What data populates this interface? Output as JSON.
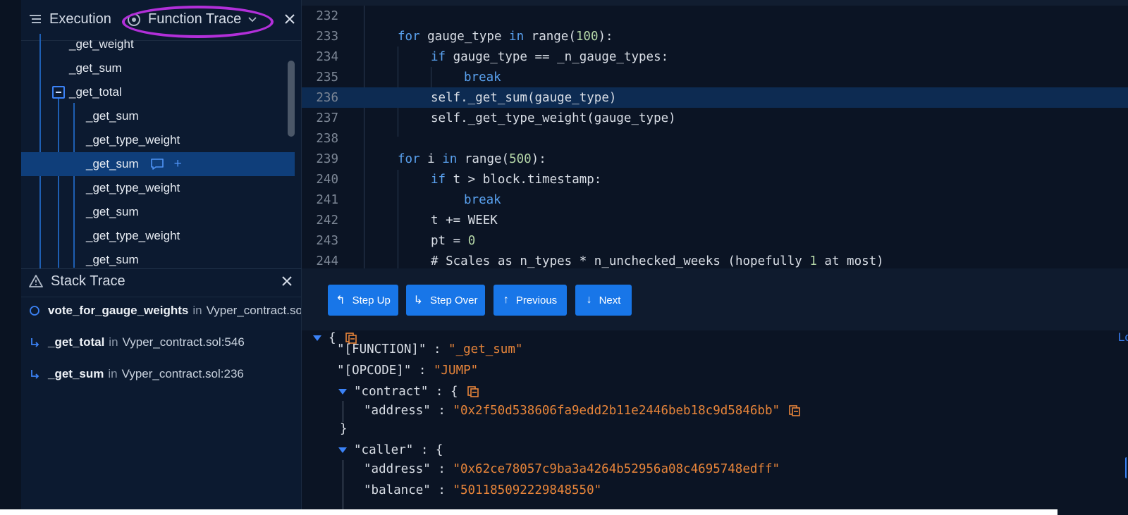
{
  "function_trace_panel": {
    "tab_execution": "Execution",
    "tab_function_trace": "Function Trace",
    "tree_items": [
      {
        "label": "_get_weight",
        "level": 1
      },
      {
        "label": "_get_sum",
        "level": 1
      },
      {
        "label": "_get_total",
        "level": 1,
        "collapsible": true
      },
      {
        "label": "_get_sum",
        "level": 2
      },
      {
        "label": "_get_type_weight",
        "level": 2
      },
      {
        "label": "_get_sum",
        "level": 2,
        "selected": true
      },
      {
        "label": "_get_type_weight",
        "level": 2
      },
      {
        "label": "_get_sum",
        "level": 2
      },
      {
        "label": "_get_type_weight",
        "level": 2
      },
      {
        "label": "_get_sum",
        "level": 2
      }
    ],
    "selected_row_plus": "+"
  },
  "stack_trace_panel": {
    "title": "Stack Trace",
    "frames": [
      {
        "fn": "vote_for_gauge_weights",
        "in": "in",
        "loc": "Vyper_contract.sol"
      },
      {
        "fn": "_get_total",
        "in": "in",
        "loc": "Vyper_contract.sol:546"
      },
      {
        "fn": "_get_sum",
        "in": "in",
        "loc": "Vyper_contract.sol:236"
      }
    ]
  },
  "editor": {
    "active_line": "236",
    "lines": [
      {
        "n": "232"
      },
      {
        "n": "233",
        "parts": [
          [
            "kw",
            "for"
          ],
          [
            "t",
            " gauge_type "
          ],
          [
            "kw",
            "in"
          ],
          [
            "t",
            " range("
          ],
          [
            "num",
            "100"
          ],
          [
            "t",
            "):"
          ]
        ]
      },
      {
        "n": "234",
        "parts": [
          [
            "kw",
            "if"
          ],
          [
            "t",
            " gauge_type == _n_gauge_types:"
          ]
        ]
      },
      {
        "n": "235",
        "parts": [
          [
            "kw",
            "break"
          ]
        ]
      },
      {
        "n": "236",
        "parts": [
          [
            "t",
            "self._get_sum(gauge_type)"
          ]
        ]
      },
      {
        "n": "237",
        "parts": [
          [
            "t",
            "self._get_type_weight(gauge_type)"
          ]
        ]
      },
      {
        "n": "238"
      },
      {
        "n": "239",
        "parts": [
          [
            "kw",
            "for"
          ],
          [
            "t",
            " i "
          ],
          [
            "kw",
            "in"
          ],
          [
            "t",
            " range("
          ],
          [
            "num",
            "500"
          ],
          [
            "t",
            "):"
          ]
        ]
      },
      {
        "n": "240",
        "parts": [
          [
            "kw",
            "if"
          ],
          [
            "t",
            " t > block.timestamp:"
          ]
        ]
      },
      {
        "n": "241",
        "parts": [
          [
            "kw",
            "break"
          ]
        ]
      },
      {
        "n": "242",
        "parts": [
          [
            "t",
            "t += WEEK"
          ]
        ]
      },
      {
        "n": "243",
        "parts": [
          [
            "t",
            "pt = "
          ],
          [
            "num",
            "0"
          ]
        ]
      },
      {
        "n": "244",
        "parts": [
          [
            "t",
            "# Scales as n_types * n_unchecked_weeks (hopefully "
          ],
          [
            "num",
            "1"
          ],
          [
            "t",
            " at most)"
          ]
        ]
      }
    ]
  },
  "toolbar": {
    "step_up": "Step Up",
    "step_over": "Step Over",
    "previous": "Previous",
    "next": "Next"
  },
  "json_viewer": {
    "open_brace": "{",
    "function_key": "\"[FUNCTION]\"",
    "function_value": "\"_get_sum\"",
    "opcode_key": "\"[OPCODE]\"",
    "opcode_value": "\"JUMP\"",
    "contract_key": "\"contract\"",
    "contract_address_key": "\"address\"",
    "contract_address_value": "\"0x2f50d538606fa9edd2b11e2446beb18c9d5846bb\"",
    "close_brace": "}",
    "caller_key": "\"caller\"",
    "caller_address_key": "\"address\"",
    "caller_address_value": "\"0x62ce78057c9ba3a4264b52956a08c4695748edff\"",
    "caller_balance_key": "\"balance\"",
    "caller_balance_value": "\"501185092229848550\"",
    "edge_text": "Lo"
  },
  "colors": {
    "accent": "#1876e8",
    "highlight_ring": "#b22fd9",
    "string": "#e8853a",
    "keyword": "#5aa2f0"
  }
}
